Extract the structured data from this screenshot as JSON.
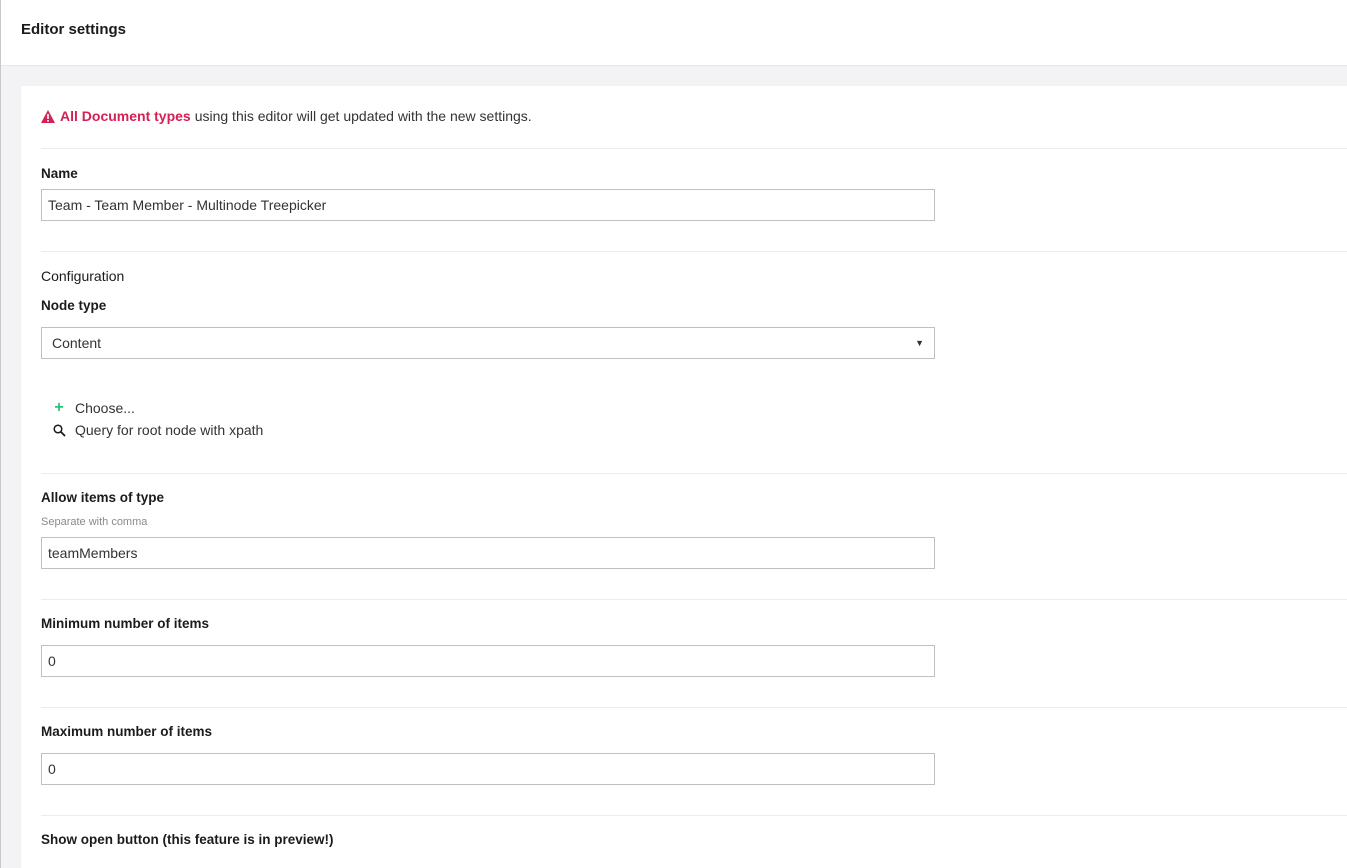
{
  "header": {
    "title": "Editor settings"
  },
  "warning": {
    "highlight": "All Document types",
    "text": "using this editor will get updated with the new settings."
  },
  "name_field": {
    "label": "Name",
    "value": "Team - Team Member - Multinode Treepicker"
  },
  "configuration": {
    "title": "Configuration",
    "node_type": {
      "label": "Node type",
      "selected": "Content"
    },
    "actions": {
      "choose": "Choose...",
      "query": "Query for root node with xpath"
    },
    "allow_items": {
      "label": "Allow items of type",
      "description": "Separate with comma",
      "value": "teamMembers"
    },
    "min_items": {
      "label": "Minimum number of items",
      "value": "0"
    },
    "max_items": {
      "label": "Maximum number of items",
      "value": "0"
    },
    "show_open_button": {
      "label": "Show open button (this feature is in preview!)"
    }
  },
  "colors": {
    "accent_warning": "#d42054",
    "plus_icon": "#2bc37c"
  }
}
